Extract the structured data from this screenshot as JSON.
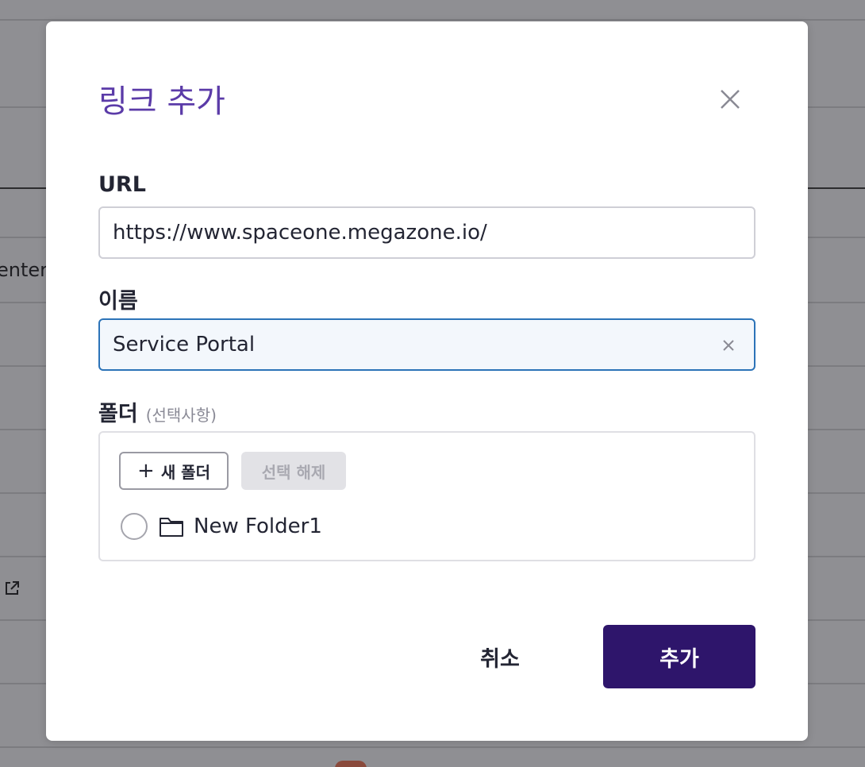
{
  "background": {
    "partial_text": "enter"
  },
  "modal": {
    "title": "링크 추가",
    "url_label": "URL",
    "url_value": "https://www.spaceone.megazone.io/",
    "name_label": "이름",
    "name_value": "Service Portal",
    "folder_label": "폴더",
    "folder_optional": "(선택사항)",
    "new_folder_plus": "+",
    "new_folder_label": "새 폴더",
    "deselect_label": "선택 해제",
    "folders": [
      {
        "name": "New Folder1",
        "selected": false
      }
    ],
    "cancel_label": "취소",
    "add_label": "추가"
  },
  "colors": {
    "title": "#5b3ba8",
    "primary_button": "#2e156b",
    "focus_border": "#2c73b8",
    "overlay": "#8f8f93"
  },
  "icons": {
    "close": "close-icon",
    "clear": "clear-icon",
    "folder": "folder-icon",
    "external_link": "external-link-icon"
  }
}
